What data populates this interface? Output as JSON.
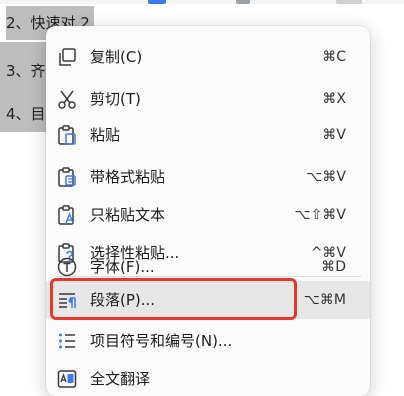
{
  "document": {
    "lines": [
      {
        "text": "2、快速对 2"
      },
      {
        "text": "3、齐"
      },
      {
        "text": "4、目"
      }
    ]
  },
  "menu": {
    "items": [
      {
        "label": "复制(C)",
        "shortcut": "⌘C",
        "icon": "copy-icon"
      },
      {
        "label": "剪切(T)",
        "shortcut": "⌘X",
        "icon": "scissors-icon"
      },
      {
        "label": "粘贴",
        "shortcut": "⌘V",
        "icon": "paste-icon"
      },
      {
        "label": "带格式粘贴",
        "shortcut": "⌥⌘V",
        "icon": "paste-format-icon"
      },
      {
        "label": "只粘贴文本",
        "shortcut": "⌥⇧⌘V",
        "icon": "paste-text-icon"
      },
      {
        "label": "选择性粘贴...",
        "shortcut": "^⌘V",
        "icon": "paste-special-icon"
      },
      {
        "label": "字体(F)...",
        "shortcut": "⌘D",
        "icon": "font-icon"
      },
      {
        "label": "段落(P)...",
        "shortcut": "⌥⌘M",
        "icon": "paragraph-icon"
      },
      {
        "label": "项目符号和编号(N)...",
        "shortcut": "",
        "icon": "list-icon"
      },
      {
        "label": "全文翻译",
        "shortcut": "",
        "icon": "translate-icon"
      }
    ],
    "hovered_item": "段落(P)..."
  },
  "colors": {
    "highlight_border": "#e8382e",
    "icon_blue": "#3a7bf5",
    "icon_dark": "#3a3a3a"
  }
}
